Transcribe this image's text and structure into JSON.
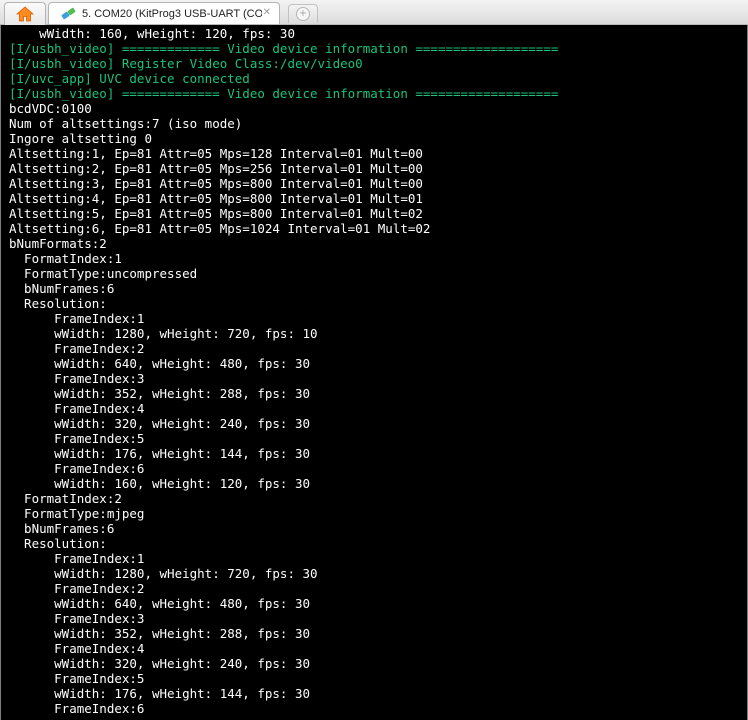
{
  "tab": {
    "label": "5. COM20  (KitProg3 USB-UART (CO",
    "close": "✕",
    "new": "+"
  },
  "terminal": {
    "lines": [
      {
        "text": "    wWidth: 160, wHeight: 120, fps: 30",
        "color": "white"
      },
      {
        "text": "[I/usbh_video] ============= Video device information ===================",
        "color": "green"
      },
      {
        "text": "[I/usbh_video] Register Video Class:/dev/video0",
        "color": "green"
      },
      {
        "text": "[I/uvc_app] UVC device connected",
        "color": "green"
      },
      {
        "text": "[I/usbh_video] ============= Video device information ===================",
        "color": "green"
      },
      {
        "text": "bcdVDC:0100",
        "color": "white"
      },
      {
        "text": "Num of altsettings:7 (iso mode)",
        "color": "white"
      },
      {
        "text": "Ingore altsetting 0",
        "color": "white"
      },
      {
        "text": "Altsetting:1, Ep=81 Attr=05 Mps=128 Interval=01 Mult=00",
        "color": "white"
      },
      {
        "text": "Altsetting:2, Ep=81 Attr=05 Mps=256 Interval=01 Mult=00",
        "color": "white"
      },
      {
        "text": "Altsetting:3, Ep=81 Attr=05 Mps=800 Interval=01 Mult=00",
        "color": "white"
      },
      {
        "text": "Altsetting:4, Ep=81 Attr=05 Mps=800 Interval=01 Mult=01",
        "color": "white"
      },
      {
        "text": "Altsetting:5, Ep=81 Attr=05 Mps=800 Interval=01 Mult=02",
        "color": "white"
      },
      {
        "text": "Altsetting:6, Ep=81 Attr=05 Mps=1024 Interval=01 Mult=02",
        "color": "white"
      },
      {
        "text": "bNumFormats:2",
        "color": "white"
      },
      {
        "text": "  FormatIndex:1",
        "color": "white"
      },
      {
        "text": "  FormatType:uncompressed",
        "color": "white"
      },
      {
        "text": "  bNumFrames:6",
        "color": "white"
      },
      {
        "text": "  Resolution:",
        "color": "white"
      },
      {
        "text": "      FrameIndex:1",
        "color": "white"
      },
      {
        "text": "      wWidth: 1280, wHeight: 720, fps: 10",
        "color": "white"
      },
      {
        "text": "      FrameIndex:2",
        "color": "white"
      },
      {
        "text": "      wWidth: 640, wHeight: 480, fps: 30",
        "color": "white"
      },
      {
        "text": "      FrameIndex:3",
        "color": "white"
      },
      {
        "text": "      wWidth: 352, wHeight: 288, fps: 30",
        "color": "white"
      },
      {
        "text": "      FrameIndex:4",
        "color": "white"
      },
      {
        "text": "      wWidth: 320, wHeight: 240, fps: 30",
        "color": "white"
      },
      {
        "text": "      FrameIndex:5",
        "color": "white"
      },
      {
        "text": "      wWidth: 176, wHeight: 144, fps: 30",
        "color": "white"
      },
      {
        "text": "      FrameIndex:6",
        "color": "white"
      },
      {
        "text": "      wWidth: 160, wHeight: 120, fps: 30",
        "color": "white"
      },
      {
        "text": "  FormatIndex:2",
        "color": "white"
      },
      {
        "text": "  FormatType:mjpeg",
        "color": "white"
      },
      {
        "text": "  bNumFrames:6",
        "color": "white"
      },
      {
        "text": "  Resolution:",
        "color": "white"
      },
      {
        "text": "      FrameIndex:1",
        "color": "white"
      },
      {
        "text": "      wWidth: 1280, wHeight: 720, fps: 30",
        "color": "white"
      },
      {
        "text": "      FrameIndex:2",
        "color": "white"
      },
      {
        "text": "      wWidth: 640, wHeight: 480, fps: 30",
        "color": "white"
      },
      {
        "text": "      FrameIndex:3",
        "color": "white"
      },
      {
        "text": "      wWidth: 352, wHeight: 288, fps: 30",
        "color": "white"
      },
      {
        "text": "      FrameIndex:4",
        "color": "white"
      },
      {
        "text": "      wWidth: 320, wHeight: 240, fps: 30",
        "color": "white"
      },
      {
        "text": "      FrameIndex:5",
        "color": "white"
      },
      {
        "text": "      wWidth: 176, wHeight: 144, fps: 30",
        "color": "white"
      },
      {
        "text": "      FrameIndex:6",
        "color": "white"
      }
    ]
  }
}
